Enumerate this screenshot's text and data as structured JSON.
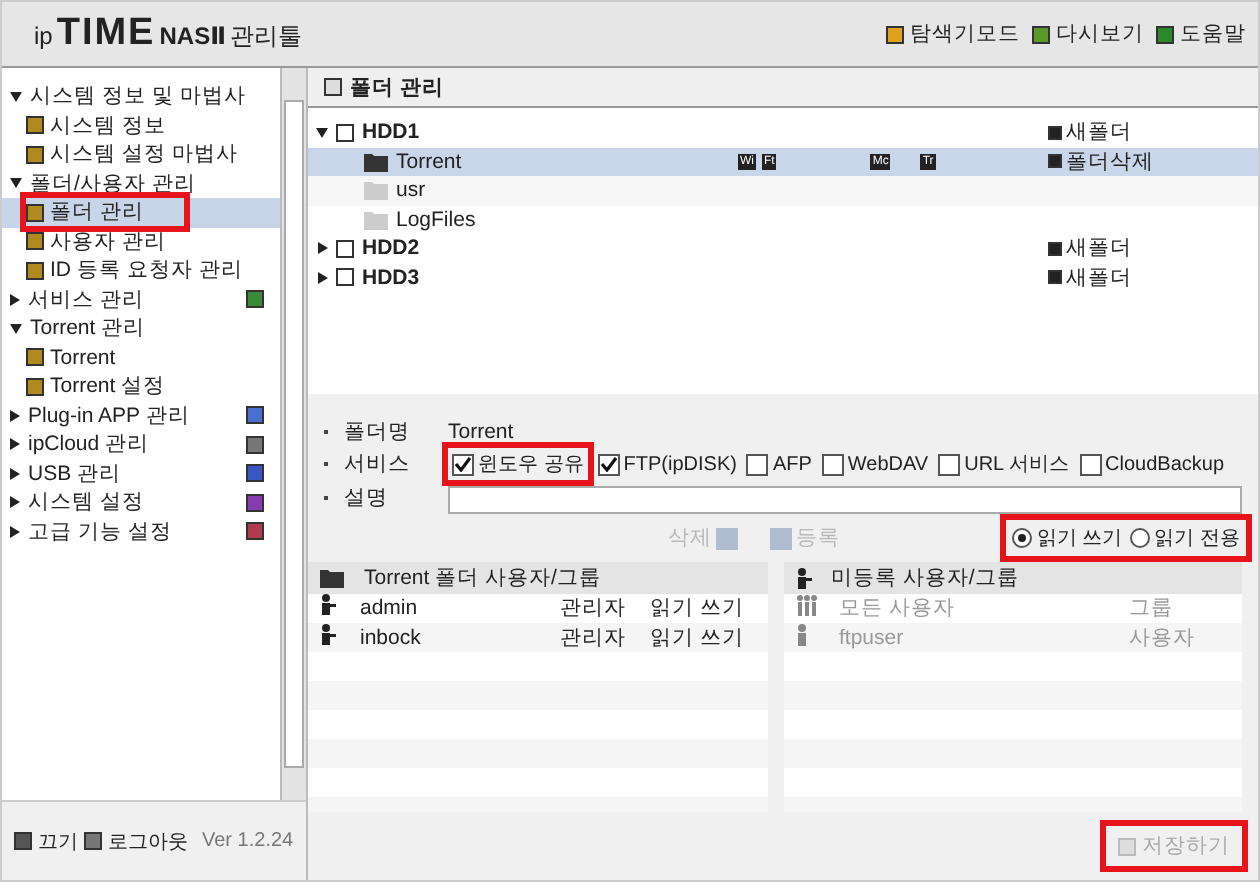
{
  "header": {
    "logo_prefix": "ip",
    "logo_brand": "TIME",
    "logo_product": "NASⅡ",
    "logo_suffix": "관리툴",
    "actions": [
      {
        "label": "탐색기모드"
      },
      {
        "label": "다시보기"
      },
      {
        "label": "도움말"
      }
    ]
  },
  "sidebar": {
    "items": [
      {
        "label": "시스템 정보 및 마법사",
        "expanded": true,
        "children": [
          {
            "label": "시스템 정보",
            "selected": false,
            "highlighted": false
          },
          {
            "label": "시스템 설정 마법사",
            "selected": false,
            "highlighted": false
          }
        ]
      },
      {
        "label": "폴더/사용자 관리",
        "expanded": true,
        "children": [
          {
            "label": "폴더 관리",
            "selected": true,
            "highlighted": true
          },
          {
            "label": "사용자 관리",
            "selected": false,
            "highlighted": false
          },
          {
            "label": "ID 등록 요청자 관리",
            "selected": false,
            "highlighted": false
          }
        ]
      },
      {
        "label": "서비스 관리",
        "expanded": false
      },
      {
        "label": "Torrent 관리",
        "expanded": true,
        "children": [
          {
            "label": "Torrent",
            "selected": false,
            "highlighted": false
          },
          {
            "label": "Torrent 설정",
            "selected": false,
            "highlighted": false
          }
        ]
      },
      {
        "label": "Plug-in APP 관리",
        "expanded": false
      },
      {
        "label": "ipCloud 관리",
        "expanded": false
      },
      {
        "label": "USB 관리",
        "expanded": false
      },
      {
        "label": "시스템 설정",
        "expanded": false
      },
      {
        "label": "고급 기능 설정",
        "expanded": false
      }
    ],
    "footer": {
      "power": "끄기",
      "logout": "로그아웃",
      "version": "Ver 1.2.24"
    }
  },
  "panel": {
    "title": "폴더 관리",
    "tree": [
      {
        "label": "HDD1",
        "expanded": true,
        "action": "새폴더",
        "children": [
          {
            "label": "Torrent",
            "selected": true,
            "action": "폴더삭제",
            "badges": [
              "Wi",
              "Ft",
              "Mc",
              "Tr"
            ]
          },
          {
            "label": "usr",
            "selected": false
          },
          {
            "label": "LogFiles",
            "selected": false
          }
        ]
      },
      {
        "label": "HDD2",
        "expanded": false,
        "action": "새폴더"
      },
      {
        "label": "HDD3",
        "expanded": false,
        "action": "새폴더"
      }
    ],
    "form": {
      "folder_name_label": "폴더명",
      "folder_name": "Torrent",
      "services_label": "서비스",
      "description_label": "설명",
      "services": [
        {
          "label": "윈도우 공유",
          "checked": true,
          "highlighted": true
        },
        {
          "label": "FTP(ipDISK)",
          "checked": true,
          "highlighted": false
        },
        {
          "label": "AFP",
          "checked": false,
          "highlighted": false
        },
        {
          "label": "WebDAV",
          "checked": false,
          "highlighted": false
        },
        {
          "label": "URL 서비스",
          "checked": false,
          "highlighted": false
        },
        {
          "label": "CloudBackup",
          "checked": false,
          "highlighted": false
        }
      ]
    },
    "remove_button": {
      "label": "삭제",
      "disabled": true
    },
    "add_button": {
      "label": "등록",
      "disabled": true
    },
    "permission": {
      "highlighted": true,
      "options": [
        {
          "label": "읽기 쓰기",
          "selected": true
        },
        {
          "label": "읽기 전용",
          "selected": false
        }
      ]
    },
    "members": {
      "title": "Torrent 폴더 사용자/그룹",
      "rows": [
        {
          "name": "admin",
          "role": "관리자",
          "permission": "읽기 쓰기"
        },
        {
          "name": "inbock",
          "role": "관리자",
          "permission": "읽기 쓰기"
        }
      ]
    },
    "unregistered": {
      "title": "미등록 사용자/그룹",
      "rows": [
        {
          "kind": "group",
          "name": "모든 사용자",
          "type": "그룹"
        },
        {
          "kind": "user",
          "name": "ftpuser",
          "type": "사용자"
        }
      ]
    },
    "save_button": {
      "label": "저장하기",
      "disabled": true,
      "highlighted": true
    }
  }
}
